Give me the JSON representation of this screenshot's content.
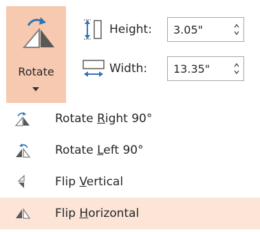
{
  "ribbon": {
    "rotate_button": {
      "label": "Rotate"
    },
    "height": {
      "label": "Height:",
      "value": "3.05\""
    },
    "width": {
      "label": "Width:",
      "value": "13.35\""
    }
  },
  "menu": {
    "items": [
      {
        "pre": "Rotate ",
        "key": "R",
        "post": "ight 90°",
        "icon": "rotate-right-icon",
        "highlighted": false
      },
      {
        "pre": "Rotate ",
        "key": "L",
        "post": "eft 90°",
        "icon": "rotate-left-icon",
        "highlighted": false
      },
      {
        "pre": "Flip ",
        "key": "V",
        "post": "ertical",
        "icon": "flip-vertical-icon",
        "highlighted": false
      },
      {
        "pre": "Flip ",
        "key": "H",
        "post": "orizontal",
        "icon": "flip-horizontal-icon",
        "highlighted": true
      }
    ]
  },
  "colors": {
    "accent_pressed": "#f7c9b0",
    "accent_hover": "#fce4d6",
    "icon_blue": "#2e75b6"
  }
}
